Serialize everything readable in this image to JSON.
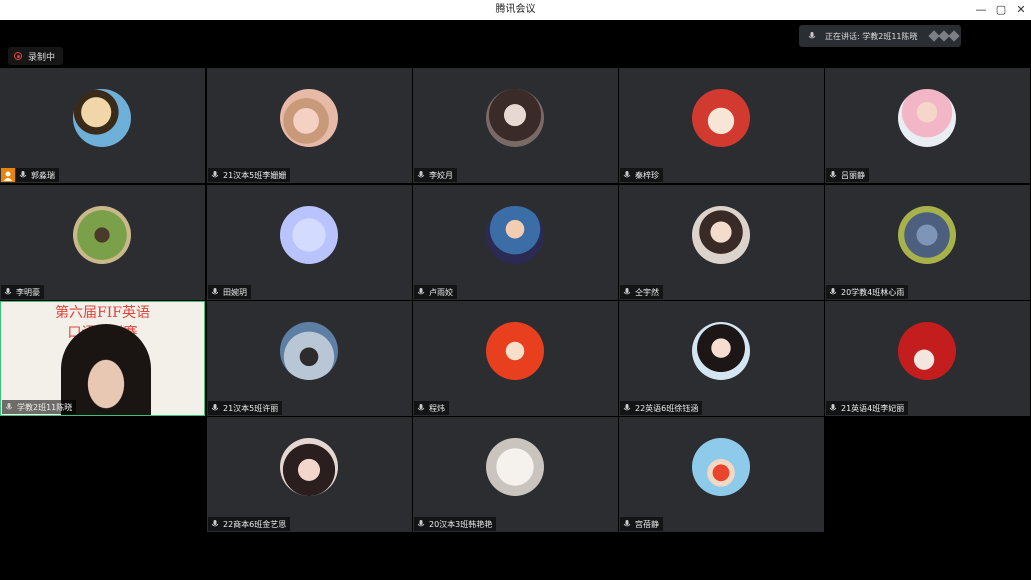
{
  "window": {
    "title": "腾讯会议"
  },
  "recording": {
    "label": "录制中"
  },
  "speaking": {
    "label": "正在讲话: 学教2班11陈晓"
  },
  "video": {
    "banner_line1": "第六届FIF英语",
    "banner_line2": "口语模拟赛"
  },
  "colors": {
    "accent": "#3bbf7a",
    "recording": "#e03a3a",
    "host": "#e8830c",
    "tile_bg": "#2c2d31"
  },
  "participants": [
    {
      "name": "郭淼瑞",
      "host": true
    },
    {
      "name": "21汉本5班李姗姗"
    },
    {
      "name": "李姣月"
    },
    {
      "name": "秦梓珍"
    },
    {
      "name": "吕丽静"
    },
    {
      "name": "李明豪"
    },
    {
      "name": "田婉玥"
    },
    {
      "name": "卢雨姣"
    },
    {
      "name": "仝宇然"
    },
    {
      "name": "20学教4班林心雨"
    },
    {
      "name": "学教2班11陈晓",
      "active_video": true
    },
    {
      "name": "21汉本5班许丽"
    },
    {
      "name": "程炜"
    },
    {
      "name": "22英语6班徐钰涵"
    },
    {
      "name": "21英语4班李妃丽"
    },
    {
      "name": "22商本6班金艺恩"
    },
    {
      "name": "20汉本3班韩艳艳"
    },
    {
      "name": "宫蓓静"
    }
  ]
}
